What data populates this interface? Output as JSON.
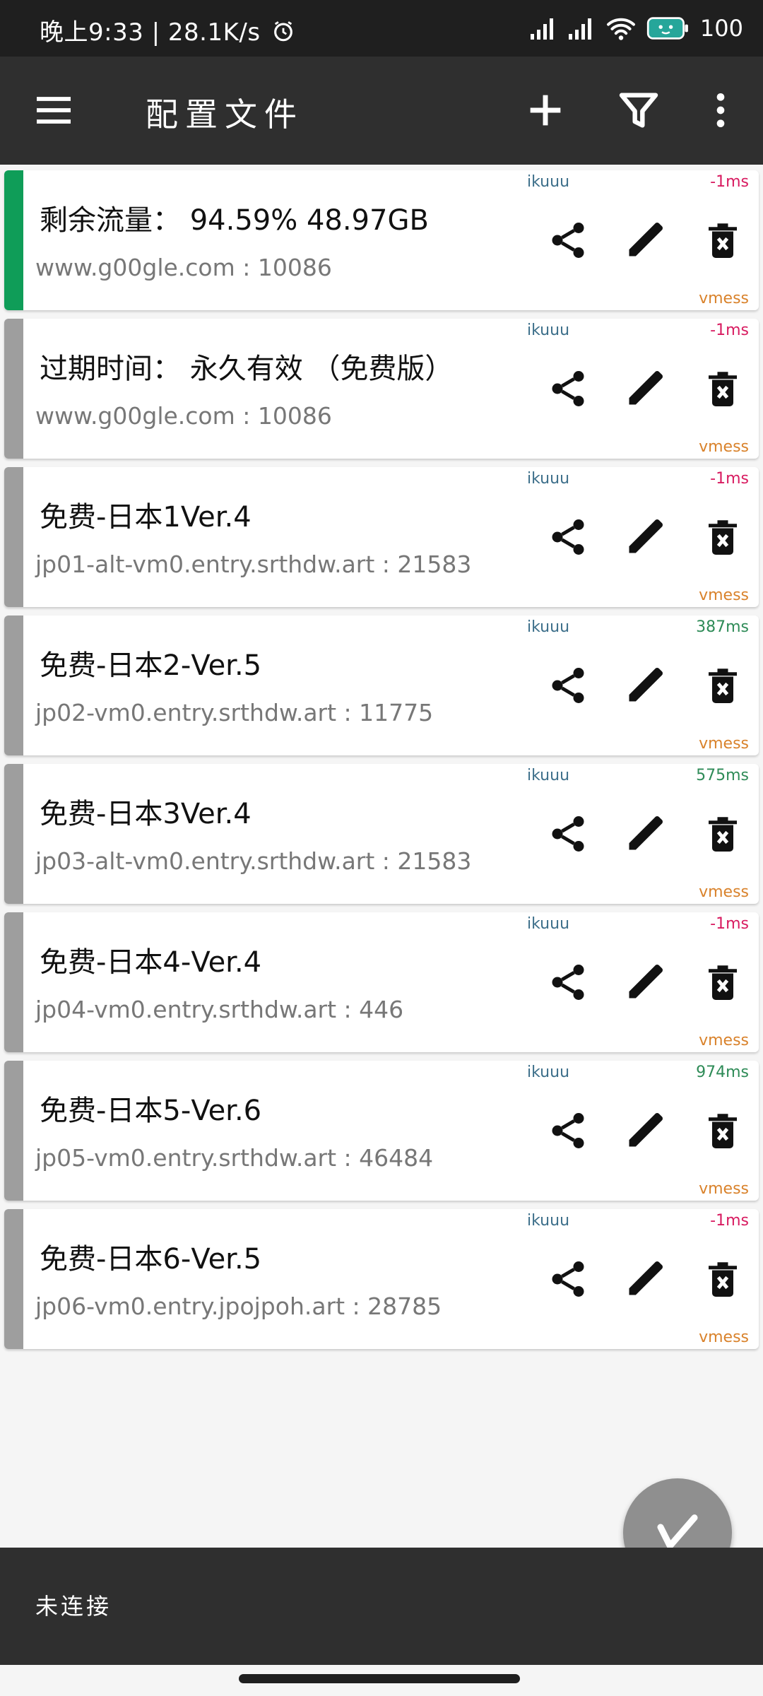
{
  "status_bar": {
    "time_speed": "晚上9:33 | 28.1K/s",
    "battery": "100"
  },
  "app_bar": {
    "title": "配置文件",
    "menu_icon": "menu-icon",
    "add_icon": "add-icon",
    "filter_icon": "filter-icon",
    "more_icon": "more-vert-icon"
  },
  "colors": {
    "active_stripe": "#0f9d58",
    "inactive_stripe": "#9e9e9e",
    "latency_fail": "#d81b60",
    "latency_ok": "#2e8b57",
    "subscription": "#3d6f8a",
    "type": "#d9822b"
  },
  "profiles": [
    {
      "title": "剩余流量： 94.59% 48.97GB",
      "address": "www.g00gle.com : 10086",
      "subscription": "ikuuu",
      "latency": "-1ms",
      "latency_ok": false,
      "type": "vmess",
      "active": true
    },
    {
      "title": "过期时间： 永久有效 （免费版）",
      "address": "www.g00gle.com : 10086",
      "subscription": "ikuuu",
      "latency": "-1ms",
      "latency_ok": false,
      "type": "vmess",
      "active": false
    },
    {
      "title": "免费-日本1Ver.4",
      "address": "jp01-alt-vm0.entry.srthdw.art : 21583",
      "subscription": "ikuuu",
      "latency": "-1ms",
      "latency_ok": false,
      "type": "vmess",
      "active": false
    },
    {
      "title": "免费-日本2-Ver.5",
      "address": "jp02-vm0.entry.srthdw.art : 11775",
      "subscription": "ikuuu",
      "latency": "387ms",
      "latency_ok": true,
      "type": "vmess",
      "active": false
    },
    {
      "title": "免费-日本3Ver.4",
      "address": "jp03-alt-vm0.entry.srthdw.art : 21583",
      "subscription": "ikuuu",
      "latency": "575ms",
      "latency_ok": true,
      "type": "vmess",
      "active": false
    },
    {
      "title": "免费-日本4-Ver.4",
      "address": "jp04-vm0.entry.srthdw.art : 446",
      "subscription": "ikuuu",
      "latency": "-1ms",
      "latency_ok": false,
      "type": "vmess",
      "active": false
    },
    {
      "title": "免费-日本5-Ver.6",
      "address": "jp05-vm0.entry.srthdw.art : 46484",
      "subscription": "ikuuu",
      "latency": "974ms",
      "latency_ok": true,
      "type": "vmess",
      "active": false
    },
    {
      "title": "免费-日本6-Ver.5",
      "address": "jp06-vm0.entry.jpojpoh.art : 28785",
      "subscription": "ikuuu",
      "latency": "-1ms",
      "latency_ok": false,
      "type": "vmess",
      "active": false
    }
  ],
  "card_actions": [
    "share-icon",
    "edit-icon",
    "delete-icon"
  ],
  "fab_icon": "v2ray-logo-icon",
  "connection_status": "未连接"
}
